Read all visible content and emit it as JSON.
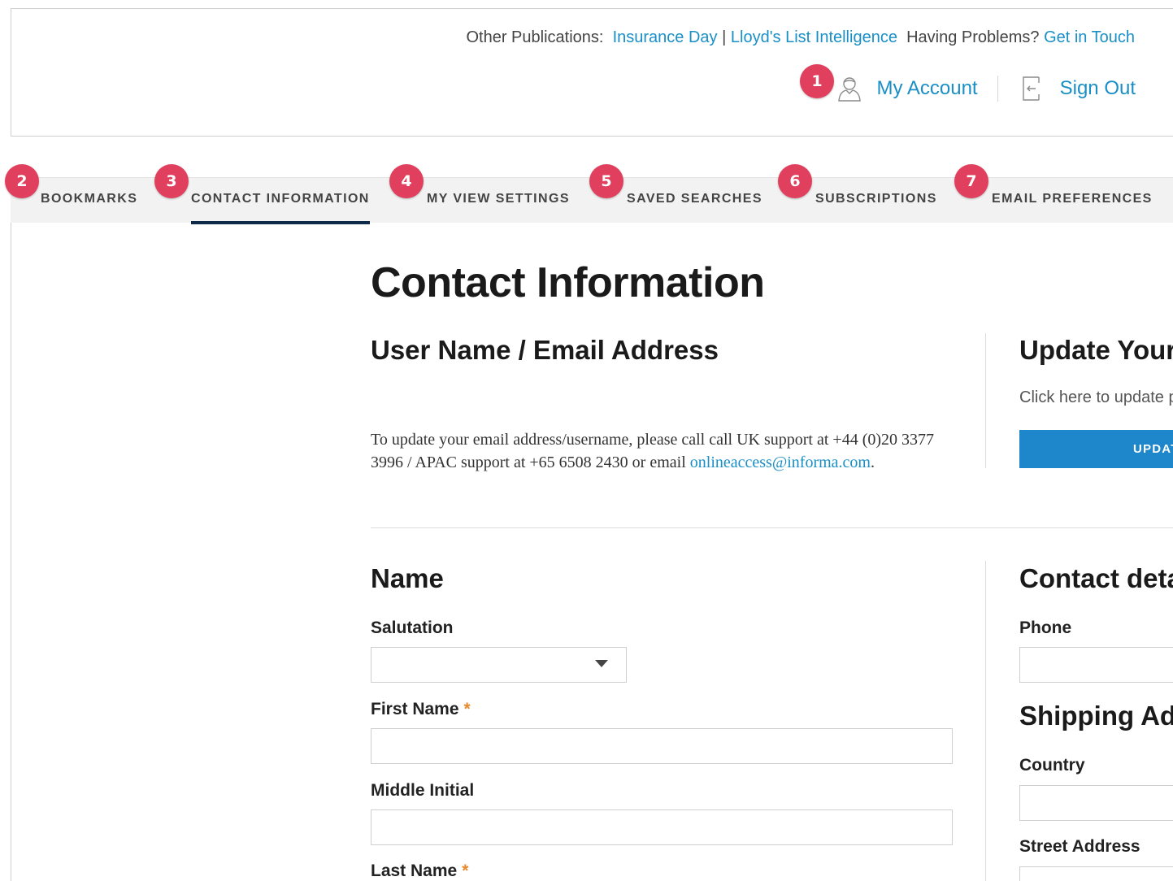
{
  "header": {
    "other_publications_label": "Other Publications:",
    "publications": [
      "Insurance Day",
      "Lloyd's List Intelligence"
    ],
    "pub_separator": "|",
    "problems_label": "Having Problems?",
    "get_in_touch": "Get in Touch",
    "my_account": "My Account",
    "sign_out": "Sign Out"
  },
  "badges": [
    "1",
    "2",
    "3",
    "4",
    "5",
    "6",
    "7"
  ],
  "tabs": [
    {
      "label": "BOOKMARKS"
    },
    {
      "label": "CONTACT INFORMATION",
      "active": true
    },
    {
      "label": "MY VIEW SETTINGS"
    },
    {
      "label": "SAVED SEARCHES"
    },
    {
      "label": "SUBSCRIPTIONS"
    },
    {
      "label": "EMAIL PREFERENCES"
    }
  ],
  "main": {
    "title": "Contact Information",
    "username_section": {
      "heading": "User Name / Email Address",
      "text": "To update your email address/username, please call call UK support at +44 (0)20 3377 3996 / APAC support at +65 6508 2430 or email",
      "email": "onlineaccess@informa.com",
      "suffix": "."
    },
    "update_section": {
      "heading": "Update Your",
      "text": "Click here to update p",
      "button": "UPDAT"
    },
    "name_section": {
      "heading": "Name",
      "salutation_label": "Salutation",
      "salutation_value": "",
      "first_name_label": "First Name",
      "first_name_value": "",
      "middle_initial_label": "Middle Initial",
      "middle_initial_value": "",
      "last_name_label": "Last Name",
      "required_mark": "*"
    },
    "contact_section": {
      "heading": "Contact deta",
      "phone_label": "Phone",
      "phone_value": ""
    },
    "shipping_section": {
      "heading": "Shipping Add",
      "country_label": "Country",
      "country_value": "",
      "street_label": "Street Address"
    }
  },
  "colors": {
    "link": "#1a8fc6",
    "badge": "#e0405e",
    "active_tab_underline": "#0f2a48",
    "button": "#1e87cb",
    "required": "#e8892c"
  },
  "icons": {
    "account": "user-icon",
    "sign_out": "sign-out-icon",
    "dropdown": "chevron-down-icon"
  }
}
